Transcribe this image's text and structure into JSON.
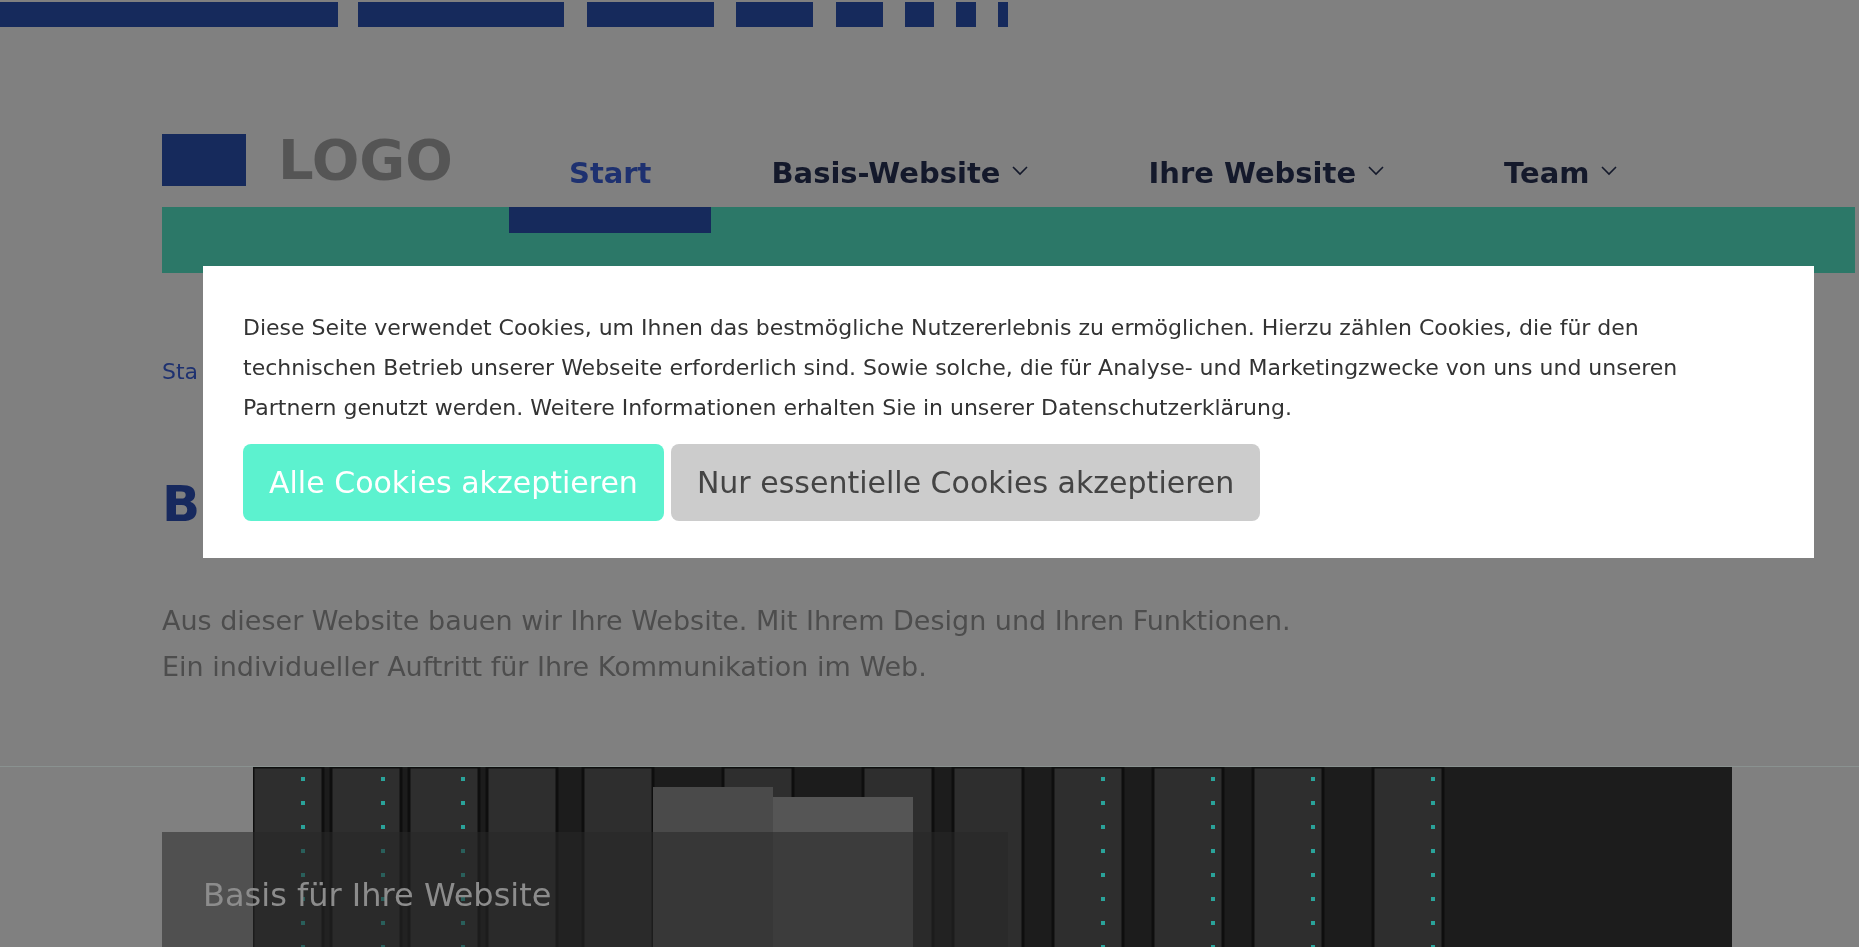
{
  "header": {
    "logo": "LOGO",
    "nav": [
      {
        "label": "Start",
        "selected": true,
        "has_submenu": false
      },
      {
        "label": "Basis-Website",
        "selected": false,
        "has_submenu": true
      },
      {
        "label": "Ihre Website",
        "selected": false,
        "has_submenu": true
      },
      {
        "label": "Team",
        "selected": false,
        "has_submenu": true
      }
    ]
  },
  "breadcrumb": "Sta",
  "heading": "B",
  "intro": [
    "Aus dieser Website bauen wir Ihre Website. Mit Ihrem Design und Ihren Funktionen.",
    "Ein individueller Auftritt für Ihre Kommunikation im Web."
  ],
  "hero": {
    "kind": "picture",
    "caption": "Basis für Ihre Website"
  },
  "cookie_dialog": {
    "text": "Diese Seite verwendet Cookies, um Ihnen das bestmögliche Nutzererlebnis zu ermöglichen. Hierzu zählen Cookies, die für den technischen Betrieb unserer Webseite erforderlich sind. Sowie solche, die für Analyse- und Marketingzwecke von uns und unseren Partnern genutzt werden. Weitere Informationen erhalten Sie in unserer Datenschutzerklärung.",
    "buttons": [
      {
        "label": "Alle Cookies akzeptieren",
        "kind": "primary"
      },
      {
        "label": "Nur essentielle Cookies akzeptieren",
        "kind": "secondary"
      }
    ]
  }
}
